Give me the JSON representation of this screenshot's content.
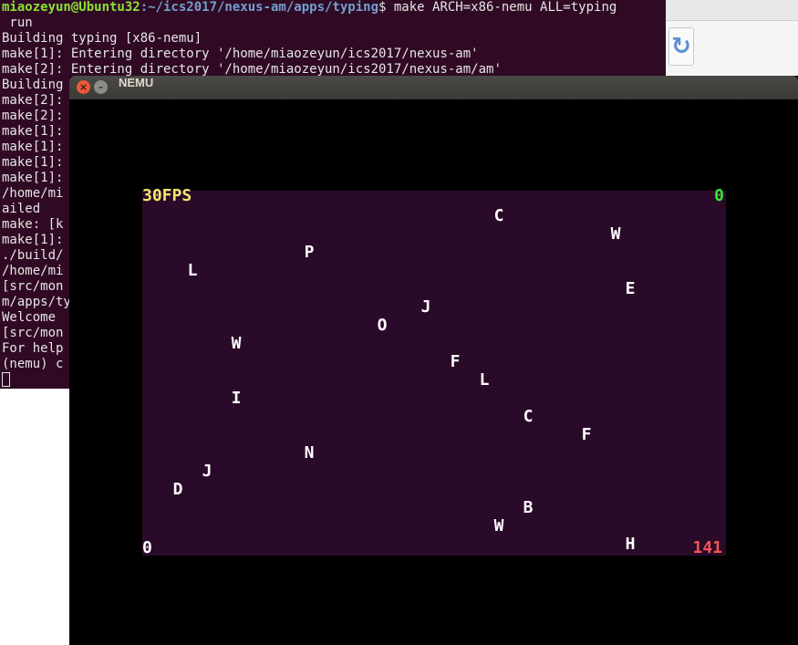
{
  "terminal": {
    "prompt_user": "miaozeyun@Ubuntu32",
    "prompt_path": ":~/ics2017/nexus-am/apps/typing",
    "prompt_cmd": "$ make ARCH=x86-nemu ALL=typing",
    "lines": [
      " run",
      "Building typing [x86-nemu]",
      "make[1]: Entering directory '/home/miaozeyun/ics2017/nexus-am'",
      "make[2]: Entering directory '/home/miaozeyun/ics2017/nexus-am/am'",
      "Building",
      "make[2]:",
      "make[2]:",
      "make[1]:",
      "make[1]:",
      "make[1]:",
      "make[1]:",
      "/home/mi",
      "ailed",
      "make: [k",
      "make[1]:",
      "./build/",
      "/home/mi",
      "[src/mon",
      "m/apps/ty",
      "Welcome ",
      "[src/mon",
      "For help",
      "(nemu) c"
    ]
  },
  "nemu": {
    "title": "NEMU",
    "fps": "30FPS",
    "hit": "0",
    "miss": "0",
    "wrong": "141",
    "letters": [
      "C",
      "W",
      "P",
      "L",
      "E",
      "J",
      "O",
      "W",
      "F",
      "L",
      "I",
      "C",
      "F",
      "N",
      "J",
      "D",
      "B",
      "W",
      "H"
    ]
  }
}
